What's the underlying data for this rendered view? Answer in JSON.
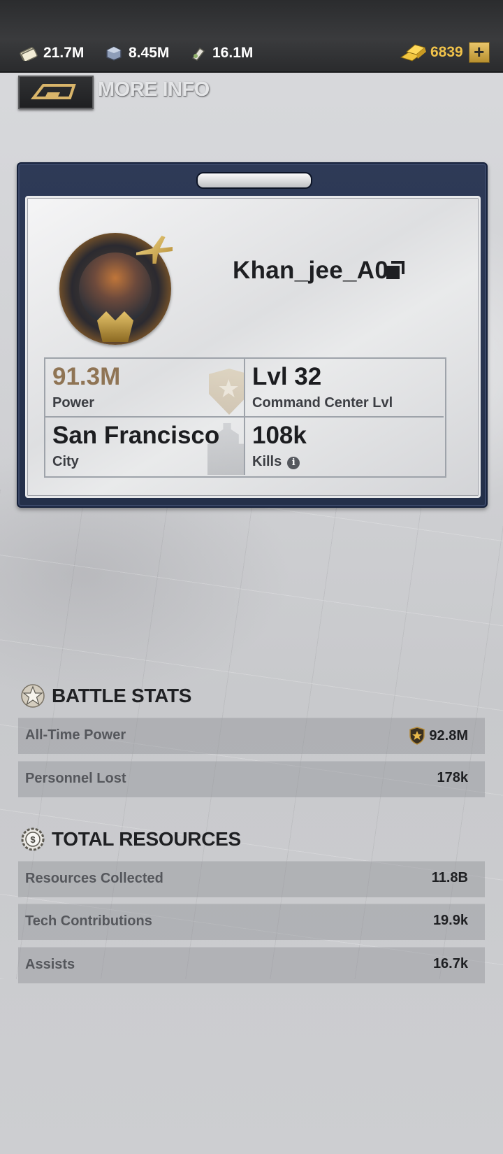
{
  "topbar": {
    "resources": [
      {
        "icon": "cash-icon",
        "value": "21.7M"
      },
      {
        "icon": "iron-icon",
        "value": "8.45M"
      },
      {
        "icon": "food-icon",
        "value": "16.1M"
      }
    ],
    "gold": {
      "icon": "gold-bars-icon",
      "value": "6839",
      "add_label": "+"
    }
  },
  "header": {
    "title": "MORE INFO"
  },
  "profile": {
    "name": "Khan_jee_A0",
    "stats": {
      "power": {
        "value": "91.3M",
        "label": "Power"
      },
      "level": {
        "value": "Lvl 32",
        "label": "Command Center Lvl"
      },
      "city": {
        "value": "San Francisco",
        "label": "City"
      },
      "kills": {
        "value": "108k",
        "label": "Kills"
      }
    }
  },
  "battle_stats": {
    "title": "BATTLE STATS",
    "rows": [
      {
        "label": "All-Time Power",
        "value": "92.8M"
      },
      {
        "label": "Personnel Lost",
        "value": "178k"
      }
    ]
  },
  "total_resources": {
    "title": "TOTAL RESOURCES",
    "rows": [
      {
        "label": "Resources Collected",
        "value": "11.8B"
      },
      {
        "label": "Tech Contributions",
        "value": "19.9k"
      },
      {
        "label": "Assists",
        "value": "16.7k"
      }
    ]
  },
  "colors": {
    "gold": "#f0c24a",
    "power_value": "#8f7454",
    "card_frame": "#2e3a57"
  }
}
